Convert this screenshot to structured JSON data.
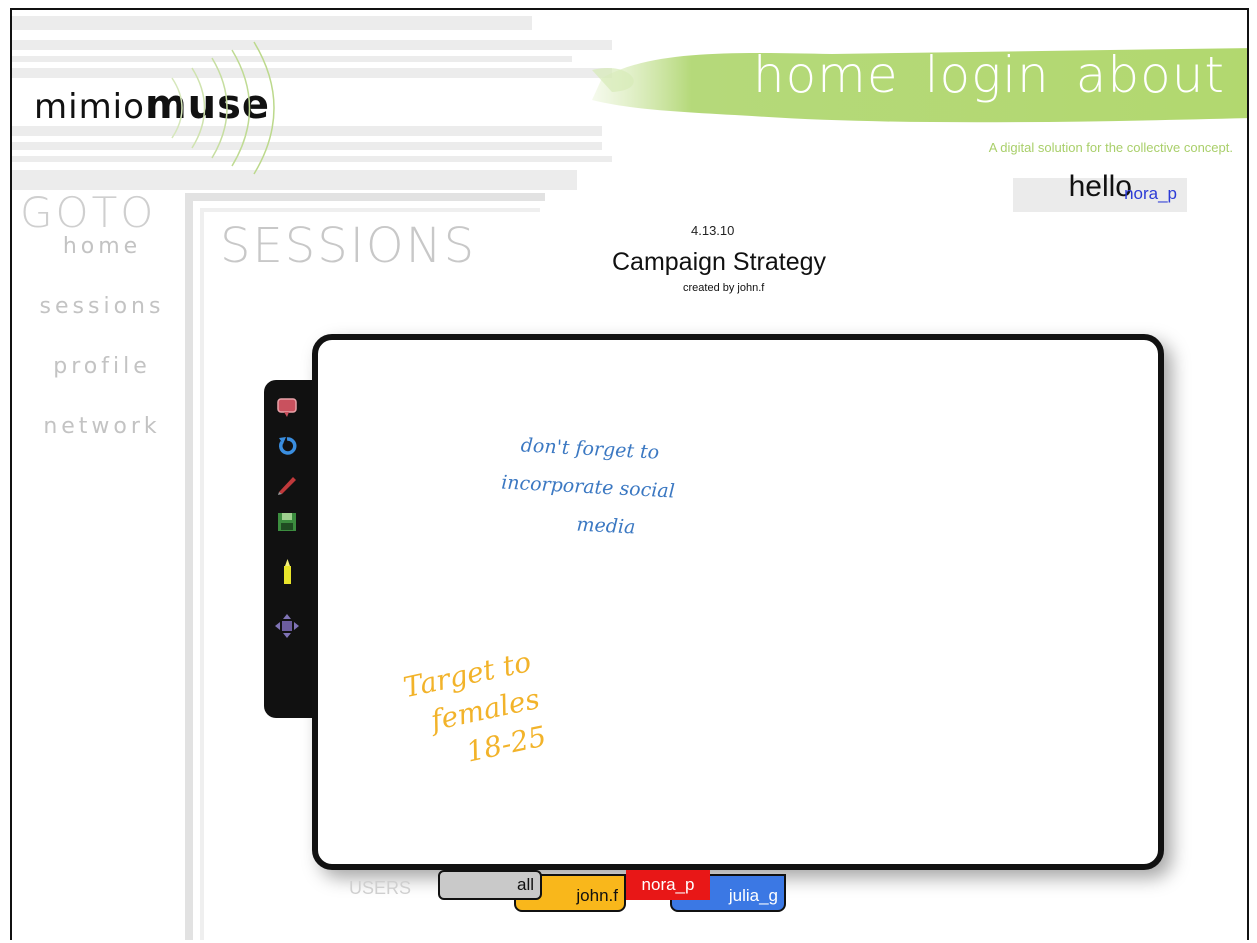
{
  "brand": {
    "part1": "mimio",
    "part2": "muse"
  },
  "nav": {
    "home": "home",
    "login": "login",
    "about": "about"
  },
  "tagline": "A digital solution for the collective concept.",
  "greeting": {
    "hello": "hello",
    "username": "nora_p"
  },
  "sidebar": {
    "goto_label": "GOTO",
    "items": [
      {
        "label": "home"
      },
      {
        "label": "sessions"
      },
      {
        "label": "profile"
      },
      {
        "label": "network"
      }
    ]
  },
  "page": {
    "title": "SESSIONS"
  },
  "session": {
    "date": "4.13.10",
    "name": "Campaign Strategy",
    "created_by": "created by john.f"
  },
  "board": {
    "notes": [
      {
        "lines": [
          "don't forget to",
          "incorporate social",
          "media"
        ],
        "color": "#3b78c2"
      },
      {
        "lines": [
          "Target to",
          "females",
          "18-25"
        ],
        "color": "#f2b32a"
      }
    ]
  },
  "toolbar": {
    "tools": [
      {
        "icon": "comment-icon"
      },
      {
        "icon": "undo-icon"
      },
      {
        "icon": "pencil-icon"
      },
      {
        "icon": "save-icon"
      },
      {
        "icon": "highlighter-icon"
      },
      {
        "icon": "move-icon"
      }
    ]
  },
  "users": {
    "label": "USERS",
    "tabs": [
      {
        "label": "all",
        "color": "#c9c9c9"
      },
      {
        "label": "john.f",
        "color": "#f9b71b"
      },
      {
        "label": "nora_p",
        "color": "#e81717"
      },
      {
        "label": "julia_g",
        "color": "#3b78e4"
      }
    ]
  },
  "colors": {
    "accent_green": "#a9cf6a",
    "username_blue": "#2c3bd6"
  }
}
